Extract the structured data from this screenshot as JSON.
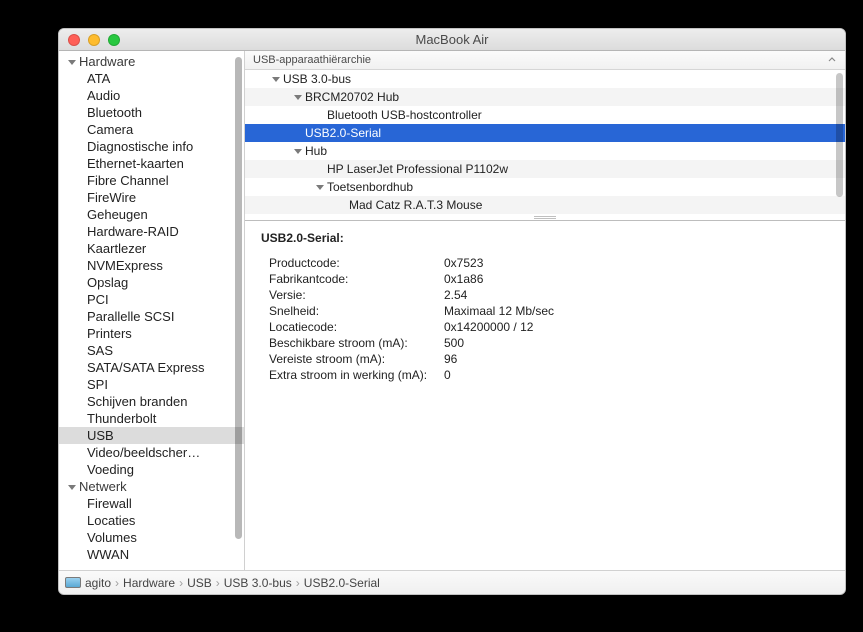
{
  "window": {
    "title": "MacBook Air"
  },
  "sidebar": {
    "categories": [
      {
        "label": "Hardware",
        "items": [
          "ATA",
          "Audio",
          "Bluetooth",
          "Camera",
          "Diagnostische info",
          "Ethernet-kaarten",
          "Fibre Channel",
          "FireWire",
          "Geheugen",
          "Hardware-RAID",
          "Kaartlezer",
          "NVMExpress",
          "Opslag",
          "PCI",
          "Parallelle SCSI",
          "Printers",
          "SAS",
          "SATA/SATA Express",
          "SPI",
          "Schijven branden",
          "Thunderbolt",
          "USB",
          "Video/beeldscher…",
          "Voeding"
        ],
        "selected": "USB"
      },
      {
        "label": "Netwerk",
        "items": [
          "Firewall",
          "Locaties",
          "Volumes",
          "WWAN"
        ]
      }
    ]
  },
  "main": {
    "header": "USB-apparaathiërarchie",
    "tree": [
      {
        "label": "USB 3.0-bus",
        "depth": 0,
        "disclose": true,
        "alt": false
      },
      {
        "label": "BRCM20702 Hub",
        "depth": 1,
        "disclose": true,
        "alt": true
      },
      {
        "label": "Bluetooth USB-hostcontroller",
        "depth": 2,
        "disclose": false,
        "alt": false
      },
      {
        "label": "USB2.0-Serial",
        "depth": 1,
        "disclose": false,
        "alt": true,
        "selected": true
      },
      {
        "label": "Hub",
        "depth": 1,
        "disclose": true,
        "alt": false
      },
      {
        "label": "HP LaserJet Professional P1102w",
        "depth": 2,
        "disclose": false,
        "alt": true
      },
      {
        "label": "Toetsenbordhub",
        "depth": 2,
        "disclose": true,
        "alt": false
      },
      {
        "label": "Mad Catz R.A.T.3 Mouse",
        "depth": 3,
        "disclose": false,
        "alt": true
      }
    ]
  },
  "details": {
    "name": "USB2.0-Serial:",
    "rows": [
      {
        "k": "Productcode:",
        "v": "0x7523"
      },
      {
        "k": "Fabrikantcode:",
        "v": "0x1a86"
      },
      {
        "k": "Versie:",
        "v": "2.54"
      },
      {
        "k": "Snelheid:",
        "v": "Maximaal 12 Mb/sec"
      },
      {
        "k": "Locatiecode:",
        "v": "0x14200000 / 12"
      },
      {
        "k": "Beschikbare stroom (mA):",
        "v": "500"
      },
      {
        "k": "Vereiste stroom (mA):",
        "v": "96"
      },
      {
        "k": "Extra stroom in werking (mA):",
        "v": "0"
      }
    ]
  },
  "footer": {
    "host": "agito",
    "crumbs": [
      "Hardware",
      "USB",
      "USB 3.0-bus",
      "USB2.0-Serial"
    ]
  }
}
